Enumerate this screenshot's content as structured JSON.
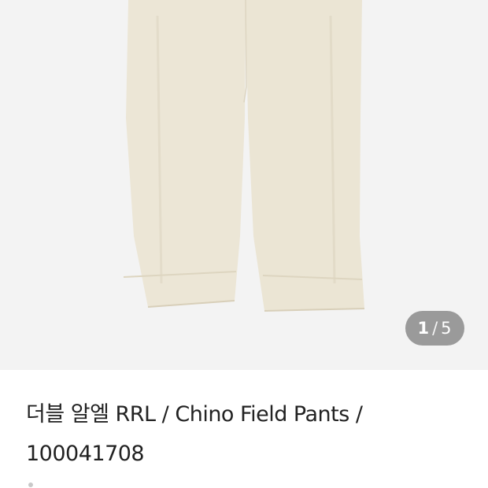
{
  "gallery": {
    "image_alt": "Cream chino field pants",
    "counter": {
      "current": "1",
      "separator": "/",
      "total": "5"
    }
  },
  "product": {
    "title_line1": "더블 알엘 RRL / Chino Field Pants /",
    "title_line2": "100041708"
  },
  "colors": {
    "pants": "#ece6d6",
    "background": "#f3f3f3",
    "counter_bg": "#8a8a8a"
  }
}
